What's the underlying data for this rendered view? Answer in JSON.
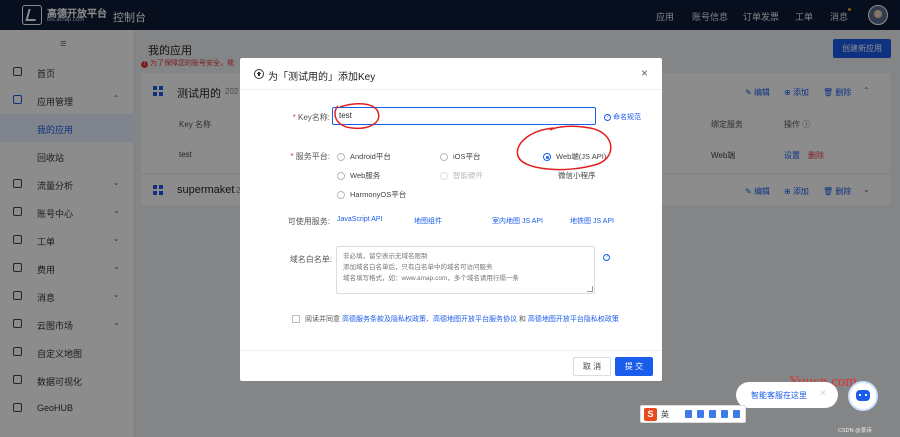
{
  "header": {
    "brand": "高德开放平台",
    "brand_sub": "lbs.amap.com",
    "console": "控制台",
    "nav": [
      "应用",
      "账号信息",
      "订单发票",
      "工单",
      "消息"
    ],
    "icons": {
      "logo": "amap-logo-icon",
      "avatar": "user-avatar"
    }
  },
  "sidebar": {
    "toggle": "≡",
    "items": [
      {
        "label": "首页",
        "icon": "home-icon"
      },
      {
        "label": "应用管理",
        "icon": "app-icon",
        "expanded": true
      },
      {
        "label": "我的应用",
        "sub": true,
        "active": true
      },
      {
        "label": "回收站",
        "sub": true
      },
      {
        "label": "流量分析",
        "icon": "chart-icon"
      },
      {
        "label": "账号中心",
        "icon": "user-icon"
      },
      {
        "label": "工单",
        "icon": "ticket-icon"
      },
      {
        "label": "费用",
        "icon": "fee-icon"
      },
      {
        "label": "消息",
        "icon": "message-icon"
      },
      {
        "label": "云图市场",
        "icon": "market-icon"
      },
      {
        "label": "自定义地图",
        "icon": "map-icon"
      },
      {
        "label": "数据可视化",
        "icon": "visual-icon"
      },
      {
        "label": "GeoHUB",
        "icon": "geohub-icon"
      }
    ]
  },
  "page": {
    "title": "我的应用",
    "warning": "为了保障您的账号安全，我",
    "create_button": "创建新应用"
  },
  "cards": [
    {
      "title": "测试用的",
      "date": "202",
      "actions": [
        "编辑",
        "添加",
        "删除"
      ],
      "table": {
        "headers": [
          "Key 名称",
          "绑定服务",
          "操作"
        ],
        "row": {
          "name": "test",
          "service": "Web端",
          "op_settings": "设置",
          "op_delete": "删除"
        }
      }
    },
    {
      "title": "supermaket",
      "date": "2",
      "actions": [
        "编辑",
        "添加",
        "删除"
      ]
    }
  ],
  "modal": {
    "title": "为「测试用的」添加Key",
    "close": "×",
    "key_name_label": "Key名称:",
    "key_name_value": "test",
    "naming_rules": "命名规范",
    "platform_label": "服务平台:",
    "platforms": [
      {
        "label": "Android平台",
        "checked": false
      },
      {
        "label": "iOS平台",
        "checked": false
      },
      {
        "label": "Web端(JS API)",
        "checked": true
      },
      {
        "label": "Web服务",
        "checked": false
      },
      {
        "label": "智能硬件",
        "checked": false,
        "disabled": true
      },
      {
        "label": "微信小程序",
        "checked": false
      },
      {
        "label": "HarmonyOS平台",
        "checked": false
      }
    ],
    "available_label": "可使用服务:",
    "available_services": [
      "JavaScript API",
      "地图组件",
      "室内地图 JS API",
      "地铁图 JS API"
    ],
    "whitelist_label": "域名白名单:",
    "whitelist_placeholder": "非必填，留空表示无域名限制\n添加域名白名单后，只有白名单中的域名可访问服务\n域名填写格式，如：www.amap.com，多个域名请用行隔一条",
    "agree_prefix": "阅读并同意",
    "agree_link1": "高德服务条款及隐私权政策",
    "agree_link2": "高德地图开放平台服务协议",
    "agree_and": "和",
    "agree_link3": "高德地图开放平台隐私权政策",
    "cancel": "取 消",
    "submit": "提 交"
  },
  "chat": {
    "text": "智能客服在这里",
    "close": "×"
  },
  "watermark": "Yuucn.com",
  "ime": {
    "s": "S",
    "lang": "英"
  },
  "footer_mark": "CSDN @景诗"
}
